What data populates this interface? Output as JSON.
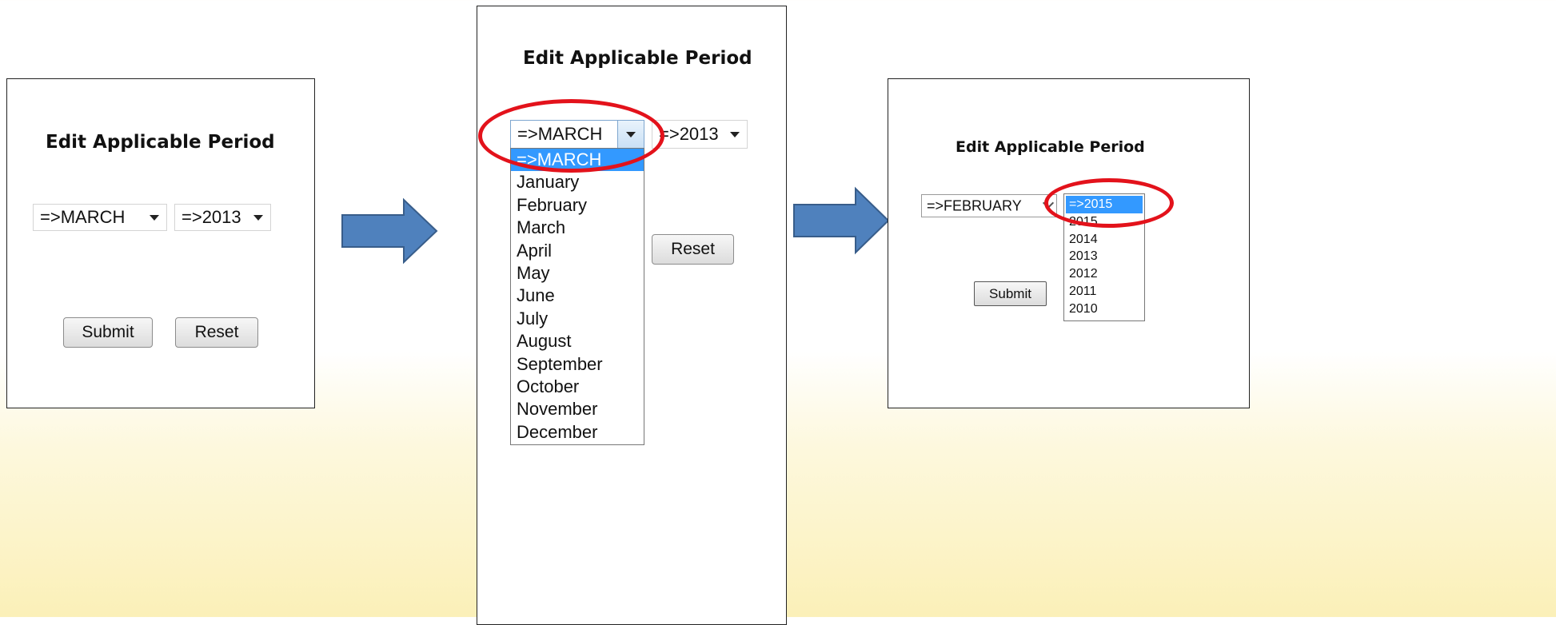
{
  "title": "Edit Applicable Period",
  "panel1": {
    "month_value": "=>MARCH",
    "year_value": "=>2013",
    "submit_label": "Submit",
    "reset_label": "Reset"
  },
  "panel2": {
    "month_value": "=>MARCH",
    "year_value": "=>2013",
    "reset_label": "Reset",
    "month_options": [
      "=>MARCH",
      "January",
      "February",
      "March",
      "April",
      "May",
      "June",
      "July",
      "August",
      "September",
      "October",
      "November",
      "December"
    ]
  },
  "panel3": {
    "month_value": "=>FEBRUARY",
    "submit_label": "Submit",
    "year_options": [
      "=>2015",
      "2015",
      "2014",
      "2013",
      "2012",
      "2011",
      "2010"
    ]
  },
  "icons": {
    "flow_arrow": "right-arrow-icon",
    "dropdown_caret": "caret-down-icon"
  },
  "colors": {
    "arrow_fill": "#4f81bd",
    "highlight_ring": "#e3121b",
    "selected_option": "#3399ff"
  }
}
